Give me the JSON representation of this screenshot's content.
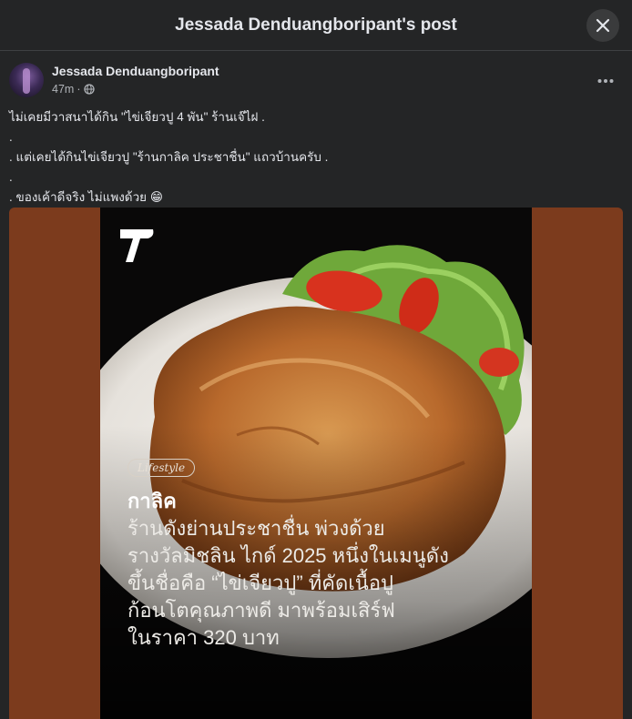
{
  "header": {
    "title": "Jessada Denduangboripant's post"
  },
  "post": {
    "author": "Jessada Denduangboripant",
    "time": "47m",
    "privacy_icon": "globe-icon",
    "lines": [
      "ไม่เคยมีวาสนาได้กิน \"ไข่เจียวปู 4 พัน\" ร้านเจ๊ไฝ .",
      ".",
      ". แต่เคยได้กินไข่เจียวปู \"ร้านกาลิค ประชาชื่น\" แถวบ้านครับ .",
      ".",
      ". ของเค้าดีจริง ไม่แพงด้วย 😁"
    ]
  },
  "image": {
    "tag": "Lifestyle",
    "title": "กาลิค",
    "body_lines": [
      "ร้านดังย่านประชาชื่น พ่วงด้วย",
      "รางวัลมิชลิน ไกด์ 2025 หนึ่งในเมนูดัง",
      "ขึ้นชื่อคือ “ไข่เจียวปู” ที่คัดเนื้อปู",
      "ก้อนโตคุณภาพดี มาพร้อมเสิร์ฟ",
      "ในราคา 320 บาท"
    ]
  },
  "colors": {
    "background": "#242526",
    "image_border": "#7c3b1d",
    "text": "#e4e6eb",
    "muted": "#b0b3b8"
  }
}
